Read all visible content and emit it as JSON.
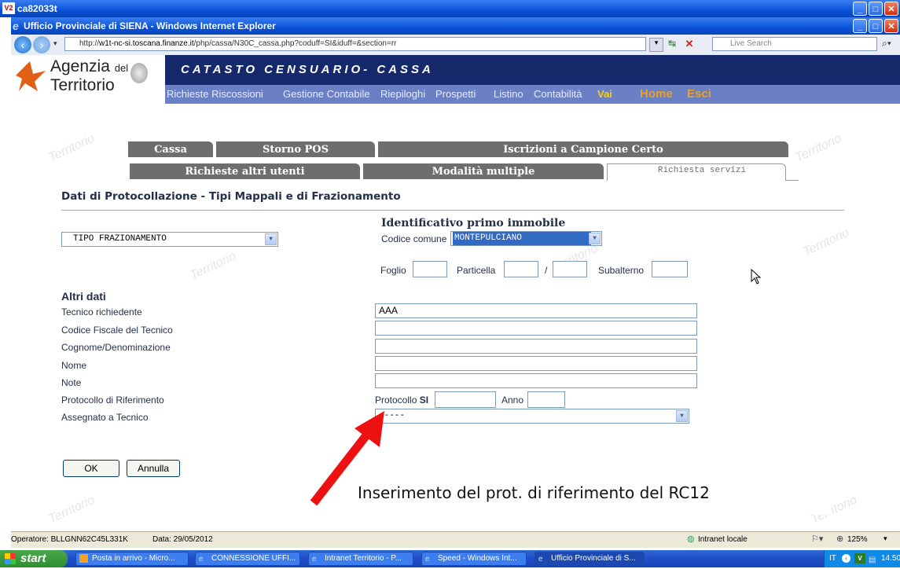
{
  "outer_window": {
    "title": "ca82033t",
    "icon": "app-icon"
  },
  "ie_window": {
    "title": "Ufficio Provinciale di SIENA - Windows Internet Explorer"
  },
  "address": {
    "url_prefix": "http://",
    "url_host": "w1t-nc-si.toscana.finanze.it",
    "url_path": "/php/cassa/N30C_cassa.php?coduff=SI&iduff=&section=rr",
    "search_placeholder": "Live Search"
  },
  "logo": {
    "line1": "Agenzia",
    "del": "del",
    "line2": "Territorio"
  },
  "app_title": "CATASTO CENSUARIO- CASSA",
  "top_nav": [
    "Richieste Riscossioni",
    "Gestione Contabile",
    "Riepiloghi",
    "Prospetti",
    "Listino",
    "Contabilità",
    "Vai",
    "Home",
    "Esci"
  ],
  "tabs_row1": [
    "Cassa",
    "Storno POS",
    "Iscrizioni a Campione Certo"
  ],
  "tabs_row2": [
    "Richieste altri utenti",
    "Modalità multiple",
    "Richiesta servizi"
  ],
  "section_title": "Dati di Protocollazione - Tipi Mappali e di Frazionamento",
  "tipo": {
    "selected": "TIPO FRAZIONAMENTO"
  },
  "immobile": {
    "heading": "Identificativo primo immobile",
    "codice_comune_label": "Codice comune",
    "codice_comune_value": "MONTEPULCIANO",
    "foglio_label": "Foglio",
    "particella_label": "Particella",
    "slash": "/",
    "subalterno_label": "Subalterno"
  },
  "altri": {
    "heading": "Altri dati",
    "tecnico_label": "Tecnico richiedente",
    "tecnico_value": "AAA",
    "cf_label": "Codice Fiscale del Tecnico",
    "cognome_label": "Cognome/Denominazione",
    "nome_label": "Nome",
    "note_label": "Note",
    "protocollo_label": "Protocollo di Riferimento",
    "protocollo_prefix": "Protocollo",
    "protocollo_si": "SI",
    "anno_label": "Anno",
    "assegnato_label": "Assegnato a Tecnico",
    "assegnato_value": "-----"
  },
  "buttons": {
    "ok": "OK",
    "annulla": "Annulla"
  },
  "annotation": "Inserimento del prot. di riferimento del RC12",
  "status": {
    "operatore": "Operatore: BLLGNN62C45L331K",
    "data": "Data: 29/05/2012",
    "zone": "Intranet locale",
    "zoom": "125%"
  },
  "taskbar": {
    "start": "start",
    "tasks": [
      "Posta in arrivo - Micro...",
      "CONNESSIONE UFFI...",
      "Intranet Territorio - P...",
      "Speed - Windows Int...",
      "Ufficio Provinciale di S..."
    ],
    "lang": "IT",
    "clock": "14.50"
  }
}
